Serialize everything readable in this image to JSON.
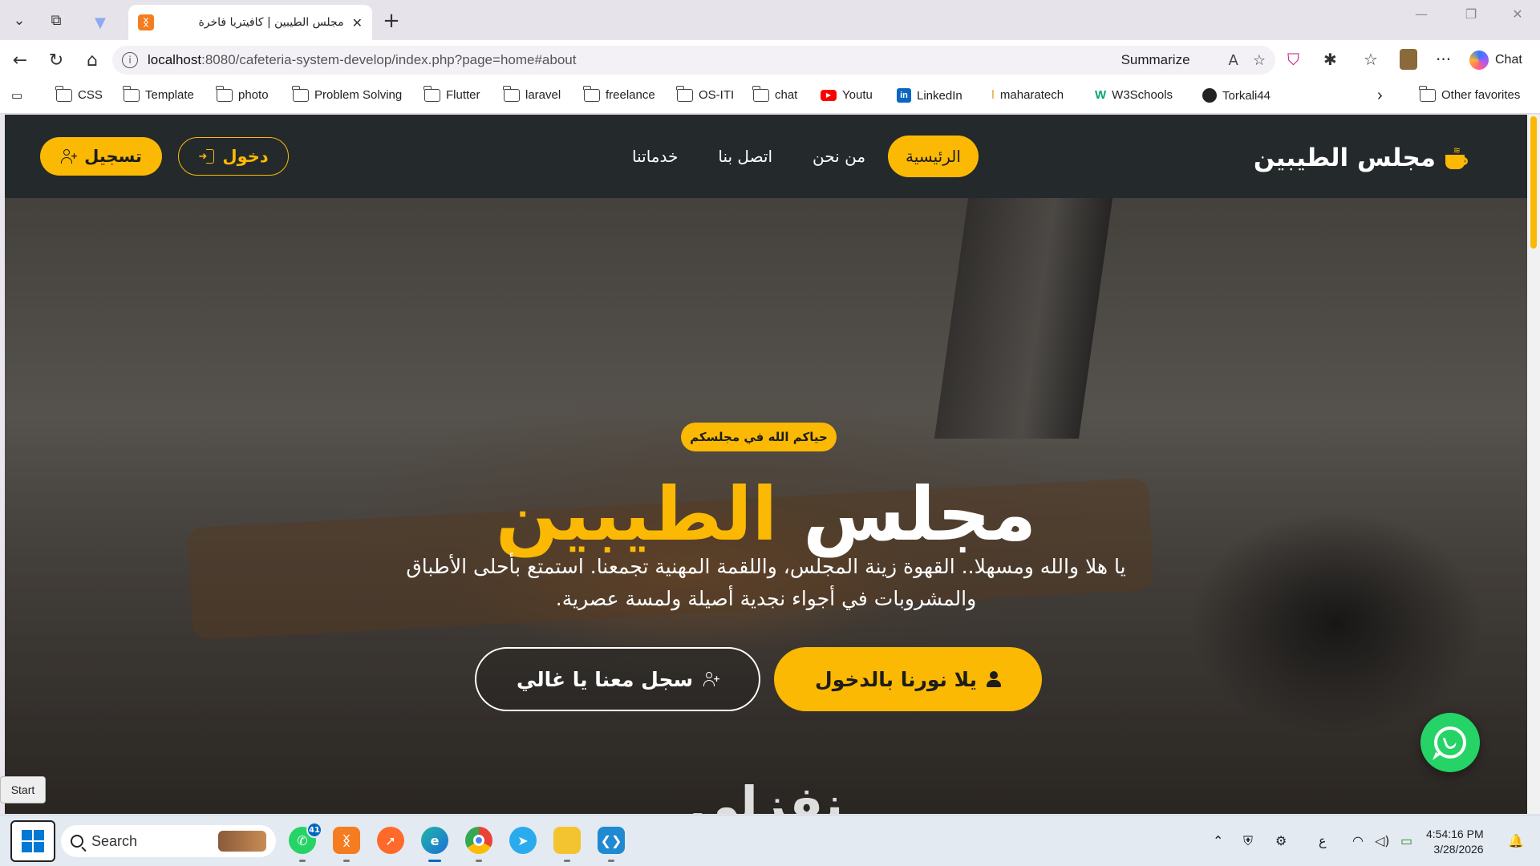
{
  "browser": {
    "active_tab_title": "مجلس الطيبين | كافيتريا فاخرة",
    "address_host": "localhost",
    "address_rest": ":8080/cafeteria-system-develop/index.php?page=home#about",
    "summarize_label": "Summarize",
    "chat_label": "Chat",
    "favorites": [
      {
        "label": "CSS",
        "icon": "folder-icon"
      },
      {
        "label": "Template",
        "icon": "folder-icon"
      },
      {
        "label": "photo",
        "icon": "folder-icon"
      },
      {
        "label": "Problem Solving",
        "icon": "folder-icon"
      },
      {
        "label": "Flutter",
        "icon": "folder-icon"
      },
      {
        "label": "laravel",
        "icon": "folder-icon"
      },
      {
        "label": "freelance",
        "icon": "folder-icon"
      },
      {
        "label": "OS-ITI",
        "icon": "folder-icon"
      },
      {
        "label": "chat",
        "icon": "folder-icon"
      },
      {
        "label": "Youtu",
        "icon": "youtube-icon"
      },
      {
        "label": "LinkedIn",
        "icon": "linkedin-icon"
      },
      {
        "label": "maharatech",
        "icon": "maharatech-icon"
      },
      {
        "label": "W3Schools",
        "icon": "w3schools-icon"
      },
      {
        "label": "Torkali44",
        "icon": "github-icon"
      }
    ],
    "other_favorites_label": "Other favorites"
  },
  "site": {
    "brand": "مجلس الطيبين",
    "nav": {
      "home": "الرئيسية",
      "about": "من نحن",
      "contact": "اتصل بنا",
      "services": "خدماتنا"
    },
    "login_label": "دخول",
    "register_label": "تسجيل",
    "hero": {
      "badge": "حياكم الله في مجلسكم",
      "title_white": "مجلس",
      "title_yellow": "الطيبين",
      "subtitle": "يا هلا والله ومسهلا.. القهوة زينة المجلس، واللقمة المهنية تجمعنا. استمتع بأحلى الأطباق والمشروبات في أجواء نجدية أصيلة ولمسة عصرية.",
      "cta_login": "يلا نورنا بالدخول",
      "cta_register": "سجل معنا يا غالي",
      "watermark": "نفزلي"
    },
    "colors": {
      "accent": "#fbb904",
      "nav_bg": "#24292c",
      "whatsapp": "#25d366"
    }
  },
  "start_tooltip": "Start",
  "taskbar": {
    "search_placeholder": "Search",
    "whatsapp_badge": "41",
    "ime": "ع",
    "time": "4:54:16 PM",
    "date": "3/28/2026"
  }
}
